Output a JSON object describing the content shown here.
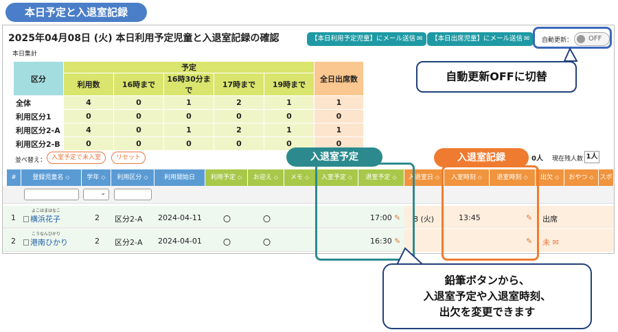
{
  "tag_title": "本日予定と入退室記録",
  "header": {
    "title": "2025年04月08日 (火) 本日利用予定児童と入退室記録の確認",
    "mail_btn_1": "【本日利用予定児童】にメール送信",
    "mail_btn_2": "【本日出席児童】にメール送信",
    "auto_update_label": "自動更新：",
    "toggle_text": "OFF",
    "icons": {
      "mail": "mail-icon"
    }
  },
  "summary": {
    "label": "本日集計",
    "cat_header": "区分",
    "plan_header": "予定",
    "att_header": "全日出席数",
    "columns": [
      "利用数",
      "16時まで",
      "16時30分まで",
      "17時まで",
      "19時まで"
    ],
    "rows": [
      {
        "label": "全体",
        "values": [
          "4",
          "0",
          "1",
          "2",
          "1"
        ],
        "att": "1"
      },
      {
        "label": "利用区分1",
        "values": [
          "0",
          "0",
          "0",
          "0",
          "0"
        ],
        "att": "0"
      },
      {
        "label": "利用区分2-A",
        "values": [
          "4",
          "0",
          "1",
          "2",
          "1"
        ],
        "att": "1"
      },
      {
        "label": "利用区分2-B",
        "values": [
          "0",
          "0",
          "0",
          "0",
          "0"
        ],
        "att": "0"
      }
    ]
  },
  "sort": {
    "label": "並べ替え：",
    "btn_1": "入室予定で未入室",
    "btn_2": "リセット"
  },
  "remaining": {
    "a": "0人",
    "label": "現在残人数",
    "b": "1人"
  },
  "table": {
    "columns": [
      "#",
      "登録児童名",
      "学年",
      "利用区分",
      "利用開始日",
      "利用予定",
      "お迎え",
      "メモ",
      "入室予定",
      "退室予定",
      "入退室日",
      "入室時刻",
      "退室時刻",
      "出欠",
      "おやつ",
      "スポ"
    ],
    "rows": [
      {
        "num": "1",
        "ruby": "よこはまはなこ",
        "name": "横浜花子",
        "grade": "2",
        "category": "区分2-A",
        "start_date": "2024-04-11",
        "plan": "〇",
        "pickup": "〇",
        "leave_plan": "17:00",
        "date": "8 (火)",
        "in_time": "13:45",
        "attendance": "出席"
      },
      {
        "num": "2",
        "ruby": "こうなんひかり",
        "name": "港南ひかり",
        "grade": "2",
        "category": "区分2-A",
        "start_date": "2024-04-01",
        "plan": "〇",
        "pickup": "〇",
        "leave_plan": "16:30",
        "date": "",
        "in_time": "",
        "attendance": "未"
      }
    ]
  },
  "callouts": {
    "teal": "入退室予定",
    "orange": "入退室記録",
    "blue_note": "自動更新OFFに切替",
    "main_note_lines": [
      "鉛筆ボタンから、",
      "入退室予定や入退室時刻、",
      "出欠を変更できます"
    ]
  },
  "colors": {
    "teal": "#2c8a8e",
    "orange": "#ef7b30",
    "blue": "#4a7ec8",
    "navy": "#1f3f7a"
  }
}
